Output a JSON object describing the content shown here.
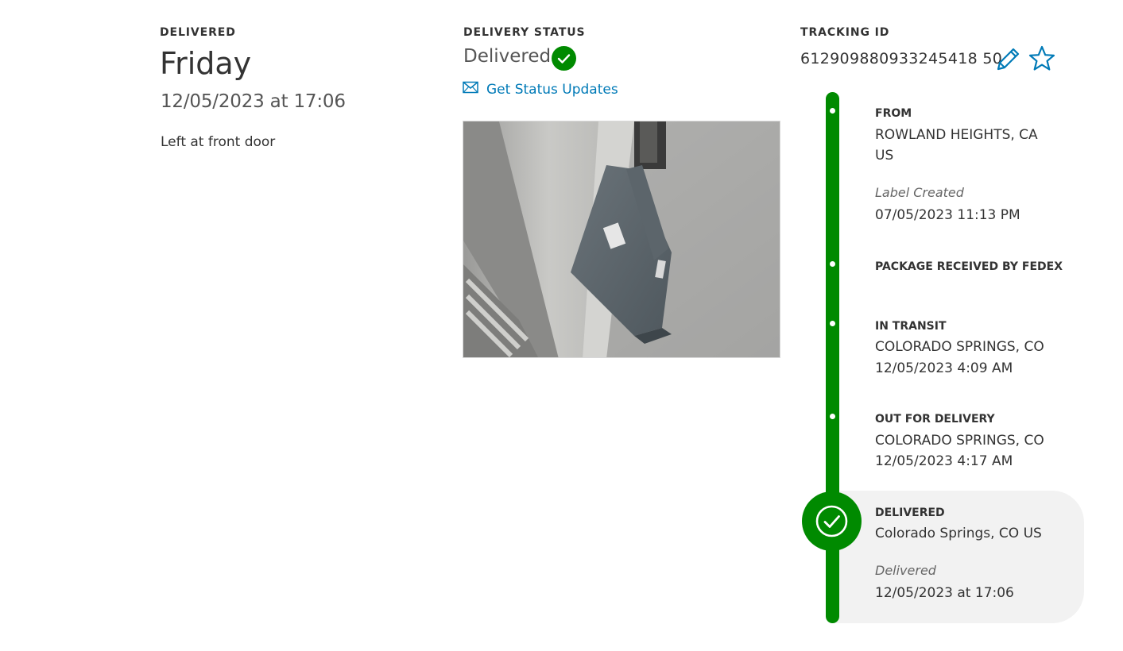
{
  "delivered_col": {
    "label": "DELIVERED",
    "day": "Friday",
    "datetime": "12/05/2023 at 17:06",
    "note": "Left at front door"
  },
  "status_col": {
    "label": "DELIVERY STATUS",
    "value": "Delivered",
    "updates_link": "Get Status Updates"
  },
  "tracking_col": {
    "label": "TRACKING ID",
    "number": "612909880933245418 50"
  },
  "timeline": {
    "from": {
      "title": "FROM",
      "line1": "ROWLAND HEIGHTS, CA",
      "line2": "US",
      "status": "Label Created",
      "datetime": "07/05/2023 11:13 PM"
    },
    "received": {
      "title": "PACKAGE RECEIVED BY FEDEX"
    },
    "in_transit": {
      "title": "IN TRANSIT",
      "location": "COLORADO SPRINGS, CO",
      "datetime": "12/05/2023 4:09 AM"
    },
    "out_for_delivery": {
      "title": "OUT FOR DELIVERY",
      "location": "COLORADO SPRINGS, CO",
      "datetime": "12/05/2023 4:17 AM"
    },
    "delivered": {
      "title": "DELIVERED",
      "location": "Colorado Springs, CO US",
      "status": "Delivered",
      "datetime": "12/05/2023 at 17:06"
    }
  },
  "icons": {
    "status_check": "check-circle-icon",
    "mail": "mail-icon",
    "edit": "pencil-icon",
    "favorite": "star-icon",
    "delivered_check": "check-circle-icon"
  },
  "colors": {
    "success_green": "#008a00",
    "link_blue": "#007ab7",
    "text_dark": "#333333",
    "highlight_bg": "#f2f2f2"
  }
}
